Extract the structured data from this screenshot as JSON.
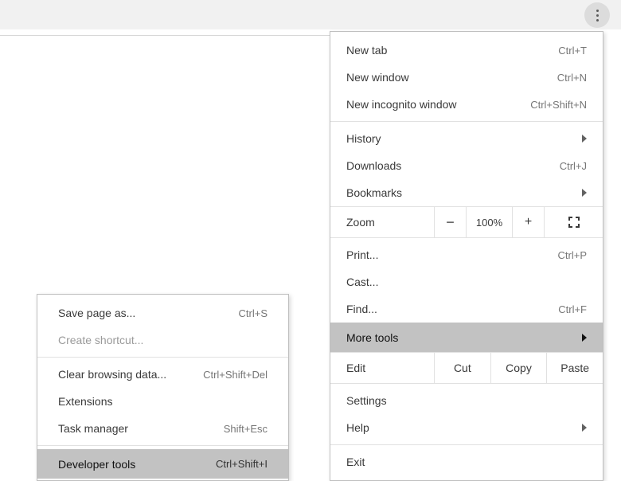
{
  "menu": {
    "new_tab": {
      "label": "New tab",
      "short": "Ctrl+T"
    },
    "new_window": {
      "label": "New window",
      "short": "Ctrl+N"
    },
    "new_incognito": {
      "label": "New incognito window",
      "short": "Ctrl+Shift+N"
    },
    "history": {
      "label": "History"
    },
    "downloads": {
      "label": "Downloads",
      "short": "Ctrl+J"
    },
    "bookmarks": {
      "label": "Bookmarks"
    },
    "zoom": {
      "label": "Zoom",
      "value": "100%",
      "minus": "−",
      "plus": "+"
    },
    "print": {
      "label": "Print...",
      "short": "Ctrl+P"
    },
    "cast": {
      "label": "Cast..."
    },
    "find": {
      "label": "Find...",
      "short": "Ctrl+F"
    },
    "more_tools": {
      "label": "More tools"
    },
    "edit": {
      "label": "Edit",
      "cut": "Cut",
      "copy": "Copy",
      "paste": "Paste"
    },
    "settings": {
      "label": "Settings"
    },
    "help": {
      "label": "Help"
    },
    "exit": {
      "label": "Exit"
    }
  },
  "submenu": {
    "save_page_as": {
      "label": "Save page as...",
      "short": "Ctrl+S"
    },
    "create_shortcut": {
      "label": "Create shortcut..."
    },
    "clear_browsing": {
      "label": "Clear browsing data...",
      "short": "Ctrl+Shift+Del"
    },
    "extensions": {
      "label": "Extensions"
    },
    "task_manager": {
      "label": "Task manager",
      "short": "Shift+Esc"
    },
    "developer_tools": {
      "label": "Developer tools",
      "short": "Ctrl+Shift+I"
    }
  }
}
